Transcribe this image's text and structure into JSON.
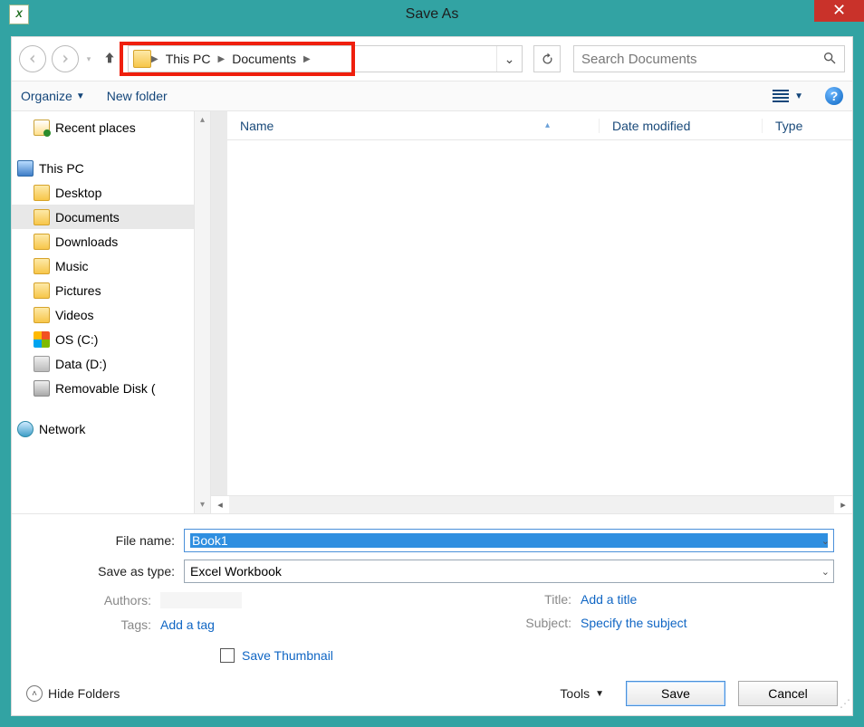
{
  "title": "Save As",
  "breadcrumb": {
    "root": "This PC",
    "folder": "Documents"
  },
  "search": {
    "placeholder": "Search Documents"
  },
  "toolbar": {
    "organize": "Organize",
    "new_folder": "New folder"
  },
  "columns": {
    "name": "Name",
    "date": "Date modified",
    "type": "Type"
  },
  "tree": {
    "recent": "Recent places",
    "this_pc": "This PC",
    "children": [
      "Desktop",
      "Documents",
      "Downloads",
      "Music",
      "Pictures",
      "Videos",
      "OS (C:)",
      "Data (D:)",
      "Removable Disk ("
    ],
    "network": "Network"
  },
  "form": {
    "file_name_label": "File name:",
    "file_name_value": "Book1",
    "save_type_label": "Save as type:",
    "save_type_value": "Excel Workbook",
    "authors_label": "Authors:",
    "tags_label": "Tags:",
    "tags_value": "Add a tag",
    "title_label": "Title:",
    "title_value": "Add a title",
    "subject_label": "Subject:",
    "subject_value": "Specify the subject",
    "thumb": "Save Thumbnail"
  },
  "footer": {
    "hide": "Hide Folders",
    "tools": "Tools",
    "save": "Save",
    "cancel": "Cancel"
  }
}
